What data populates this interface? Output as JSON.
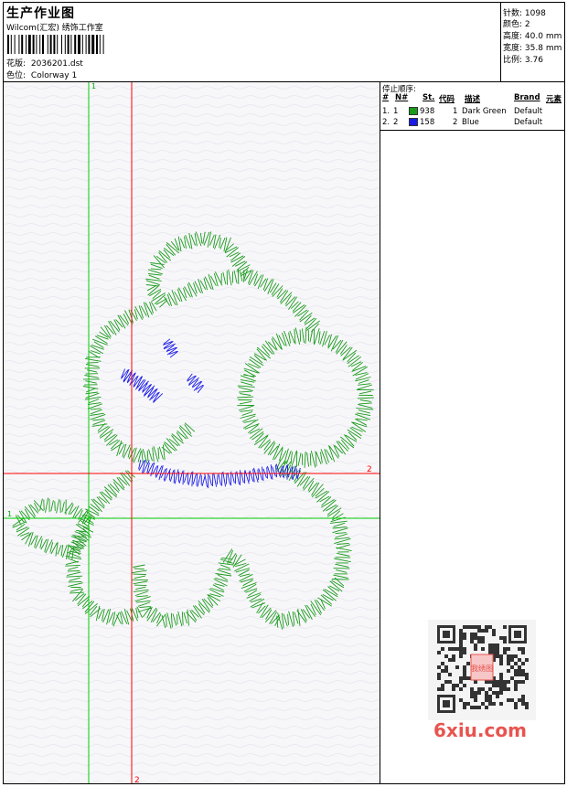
{
  "header": {
    "title": "生产作业图",
    "studio": "Wilcom(汇宏) 绣饰工作室",
    "design_label": "花版:",
    "design_value": "2036201.dst",
    "colorway_label": "色位:",
    "colorway_value": "Colorway 1"
  },
  "stats": [
    {
      "label": "针数:",
      "value": "1098"
    },
    {
      "label": "颜色:",
      "value": "2"
    },
    {
      "label": "高度:",
      "value": "40.0 mm"
    },
    {
      "label": "宽度:",
      "value": "35.8 mm"
    },
    {
      "label": "比例:",
      "value": "3.76"
    }
  ],
  "stop_sequence": {
    "title": "停止顺序:",
    "headers": [
      "#",
      "N#",
      "St.",
      "代码",
      "描述",
      "Brand",
      "元素"
    ],
    "rows": [
      {
        "idx": "1.",
        "n": "1",
        "color": "#1a9a1a",
        "stitches": "938",
        "code": "1",
        "desc": "Dark Green",
        "brand": "Default"
      },
      {
        "idx": "2.",
        "n": "2",
        "color": "#1a1ae6",
        "stitches": "158",
        "code": "2",
        "desc": "Blue",
        "brand": "Default"
      }
    ]
  },
  "guides": {
    "green_vertical_label": "1",
    "green_horizontal_label": "1",
    "red_horizontal_label": "2",
    "red_vertical_label": "2"
  },
  "watermark": {
    "logo_text": "6xiu.com",
    "qr_badge_text": "我绣图"
  },
  "colors": {
    "thread_green": "#1a9a1a",
    "thread_blue": "#1a1ae6",
    "guide_green": "#00cc00",
    "guide_red": "#ff0000",
    "logo_red": "#e8544f"
  }
}
